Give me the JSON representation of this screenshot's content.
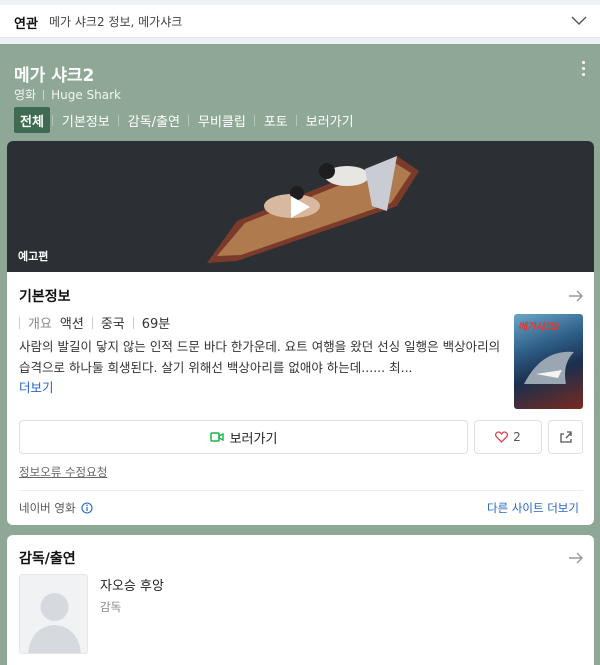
{
  "related": {
    "label": "연관",
    "text": "메가 샤크2 정보, 메가샤크"
  },
  "movie": {
    "title": "메가 샤크2",
    "category": "영화",
    "original_title": "Huge Shark"
  },
  "tabs": [
    "전체",
    "기본정보",
    "감독/출연",
    "무비클립",
    "포토",
    "보러가기"
  ],
  "video": {
    "label": "예고편"
  },
  "basic_info": {
    "title": "기본정보",
    "overview_label": "개요",
    "genre": "액션",
    "country": "중국",
    "runtime": "69분",
    "description": "사람의 발길이 닿지 않는 인적 드문 바다 한가운데. 요트 여행을 왔던 선싱 일행은 백상아리의 습격으로 하나둘 희생된다. 살기 위해선 백상아리를 없애야 하는데...... 최...",
    "more": "더보기",
    "poster_title": "메가샤크2"
  },
  "actions": {
    "watch": "보러가기",
    "like_count": "2"
  },
  "report": "정보오류 수정요청",
  "footer": {
    "source": "네이버 영화",
    "other_sites": "다른 사이트 더보기"
  },
  "cast": {
    "title": "감독/출연",
    "people": [
      {
        "name": "자오승 후앙",
        "role": "감독"
      }
    ]
  },
  "colors": {
    "hero_bg": "#8ea895",
    "active_tab": "#3e6b51",
    "link": "#2465c7",
    "watch_icon": "#19b54a"
  }
}
